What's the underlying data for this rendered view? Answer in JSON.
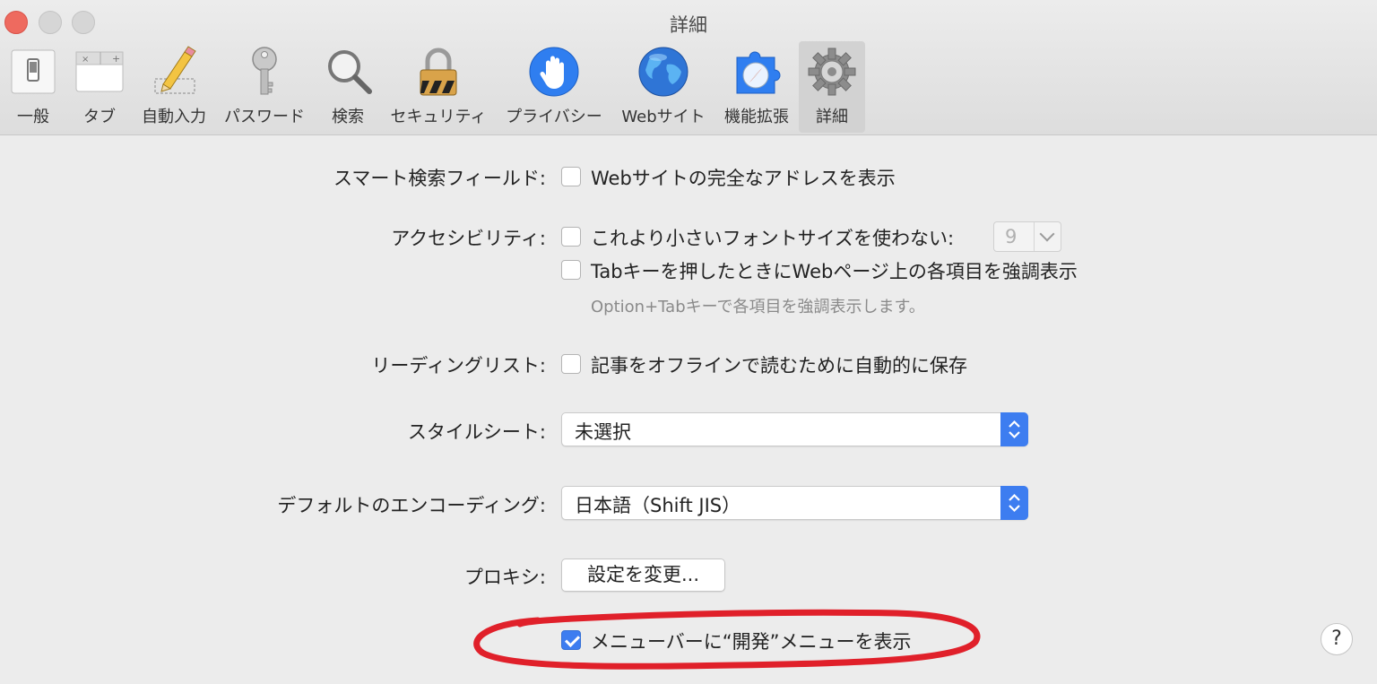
{
  "window": {
    "title": "詳細"
  },
  "toolbar": {
    "items": [
      {
        "label": "一般",
        "icon": "switch-icon"
      },
      {
        "label": "タブ",
        "icon": "tabs-icon"
      },
      {
        "label": "自動入力",
        "icon": "pencil-icon"
      },
      {
        "label": "パスワード",
        "icon": "key-icon"
      },
      {
        "label": "検索",
        "icon": "magnifier-icon"
      },
      {
        "label": "セキュリティ",
        "icon": "padlock-icon"
      },
      {
        "label": "プライバシー",
        "icon": "hand-icon"
      },
      {
        "label": "Webサイト",
        "icon": "globe-icon"
      },
      {
        "label": "機能拡張",
        "icon": "puzzle-compass-icon"
      },
      {
        "label": "詳細",
        "icon": "gear-icon",
        "selected": true
      }
    ]
  },
  "settings": {
    "smart_search": {
      "label": "スマート検索フィールド:",
      "option": "Webサイトの完全なアドレスを表示",
      "checked": false
    },
    "accessibility": {
      "label": "アクセシビリティ:",
      "option_font": "これより小さいフォントサイズを使わない:",
      "font_checked": false,
      "font_size": "9",
      "option_tab": "Tabキーを押したときにWebページ上の各項目を強調表示",
      "tab_checked": false,
      "tab_note": "Option+Tabキーで各項目を強調表示します。"
    },
    "reading_list": {
      "label": "リーディングリスト:",
      "option": "記事をオフラインで読むために自動的に保存",
      "checked": false
    },
    "style_sheet": {
      "label": "スタイルシート:",
      "value": "未選択"
    },
    "encoding": {
      "label": "デフォルトのエンコーディング:",
      "value": "日本語（Shift JIS）"
    },
    "proxy": {
      "label": "プロキシ:",
      "button": "設定を変更..."
    },
    "develop_menu": {
      "option": "メニューバーに“開発”メニューを表示",
      "checked": true
    }
  },
  "help": {
    "label": "?"
  },
  "colors": {
    "accent": "#3d7df0",
    "annotation": "#e0202a",
    "background": "#ececec"
  }
}
